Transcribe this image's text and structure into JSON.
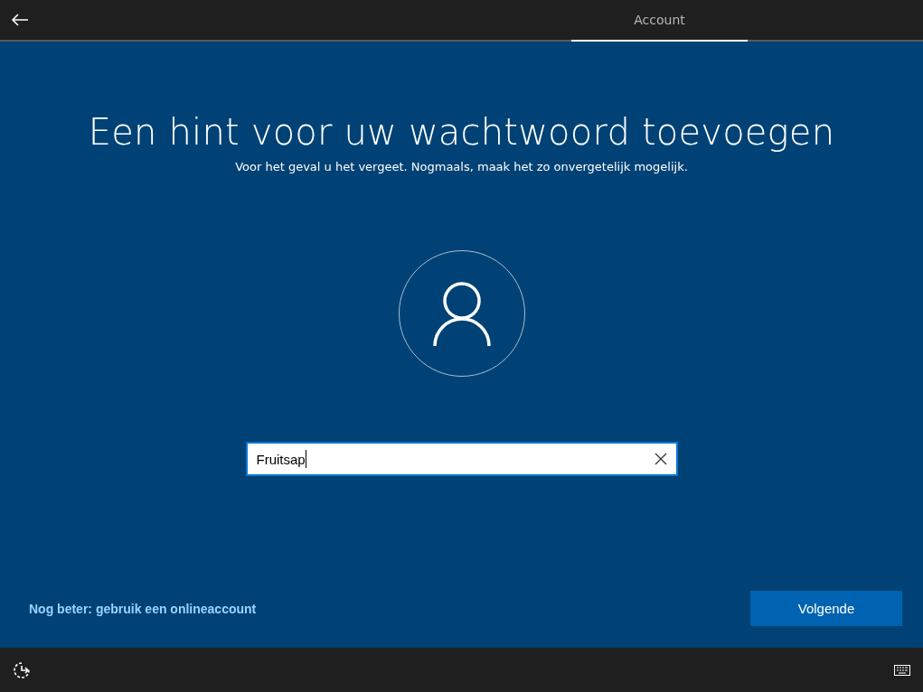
{
  "tabs": [
    {
      "label": "Account",
      "selected": true
    }
  ],
  "heading": "Een hint voor uw wachtwoord toevoegen",
  "subheading": "Voor het geval u het vergeet. Nogmaals, maak het zo onvergetelijk mogelijk.",
  "hint_field": {
    "value": "Fruitsap",
    "focused": true
  },
  "link": "Nog beter: gebruik een onlineaccount",
  "next_button": "Volgende"
}
